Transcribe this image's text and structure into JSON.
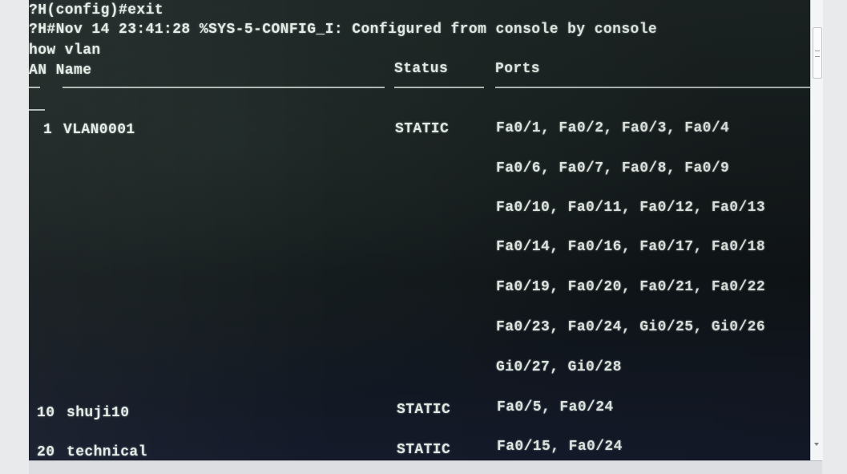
{
  "terminal": {
    "lines": [
      "?H(config)#exit",
      "?H#Nov 14 23:41:28 %SYS-5-CONFIG_I: Configured from console by console",
      "how vlan"
    ],
    "header": {
      "vlan_name": "AN Name",
      "status": "Status",
      "ports": "Ports"
    },
    "divider_wrap": "--",
    "vlans": [
      {
        "id": "1",
        "name": "VLAN0001",
        "status": "STATIC",
        "ports": [
          "Fa0/1, Fa0/2, Fa0/3, Fa0/4",
          "Fa0/6, Fa0/7, Fa0/8, Fa0/9",
          "Fa0/10, Fa0/11, Fa0/12, Fa0/13",
          "Fa0/14, Fa0/16, Fa0/17, Fa0/18",
          "Fa0/19, Fa0/20, Fa0/21, Fa0/22",
          "Fa0/23, Fa0/24, Gi0/25, Gi0/26",
          "Gi0/27, Gi0/28"
        ]
      },
      {
        "id": "10",
        "name": "shuji10",
        "status": "STATIC",
        "ports": [
          "Fa0/5, Fa0/24"
        ]
      },
      {
        "id": "20",
        "name": "technical",
        "status": "STATIC",
        "ports": [
          "Fa0/15, Fa0/24"
        ]
      }
    ]
  },
  "colors": {
    "text": "#e4ebe6",
    "background": "#151b1c",
    "chrome": "#e9eaec"
  }
}
